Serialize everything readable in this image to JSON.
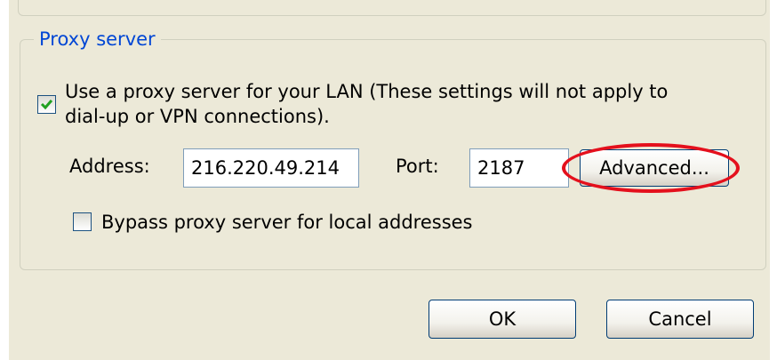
{
  "proxy_group": {
    "legend": "Proxy server",
    "use_proxy": {
      "checked": true,
      "label_line1": "Use a proxy server for your LAN (These settings will not apply to",
      "label_line2": "dial-up or VPN connections)."
    },
    "address": {
      "label": "Address:",
      "value": "216.220.49.214"
    },
    "port": {
      "label": "Port:",
      "value": "2187"
    },
    "advanced_label": "Advanced...",
    "bypass": {
      "checked": false,
      "label": "Bypass proxy server for local addresses"
    }
  },
  "buttons": {
    "ok": "OK",
    "cancel": "Cancel"
  },
  "colors": {
    "legend": "#0046d5",
    "highlight": "#e4101c",
    "check": "#21a121"
  },
  "annotation": "red-ellipse-around-advanced-button"
}
